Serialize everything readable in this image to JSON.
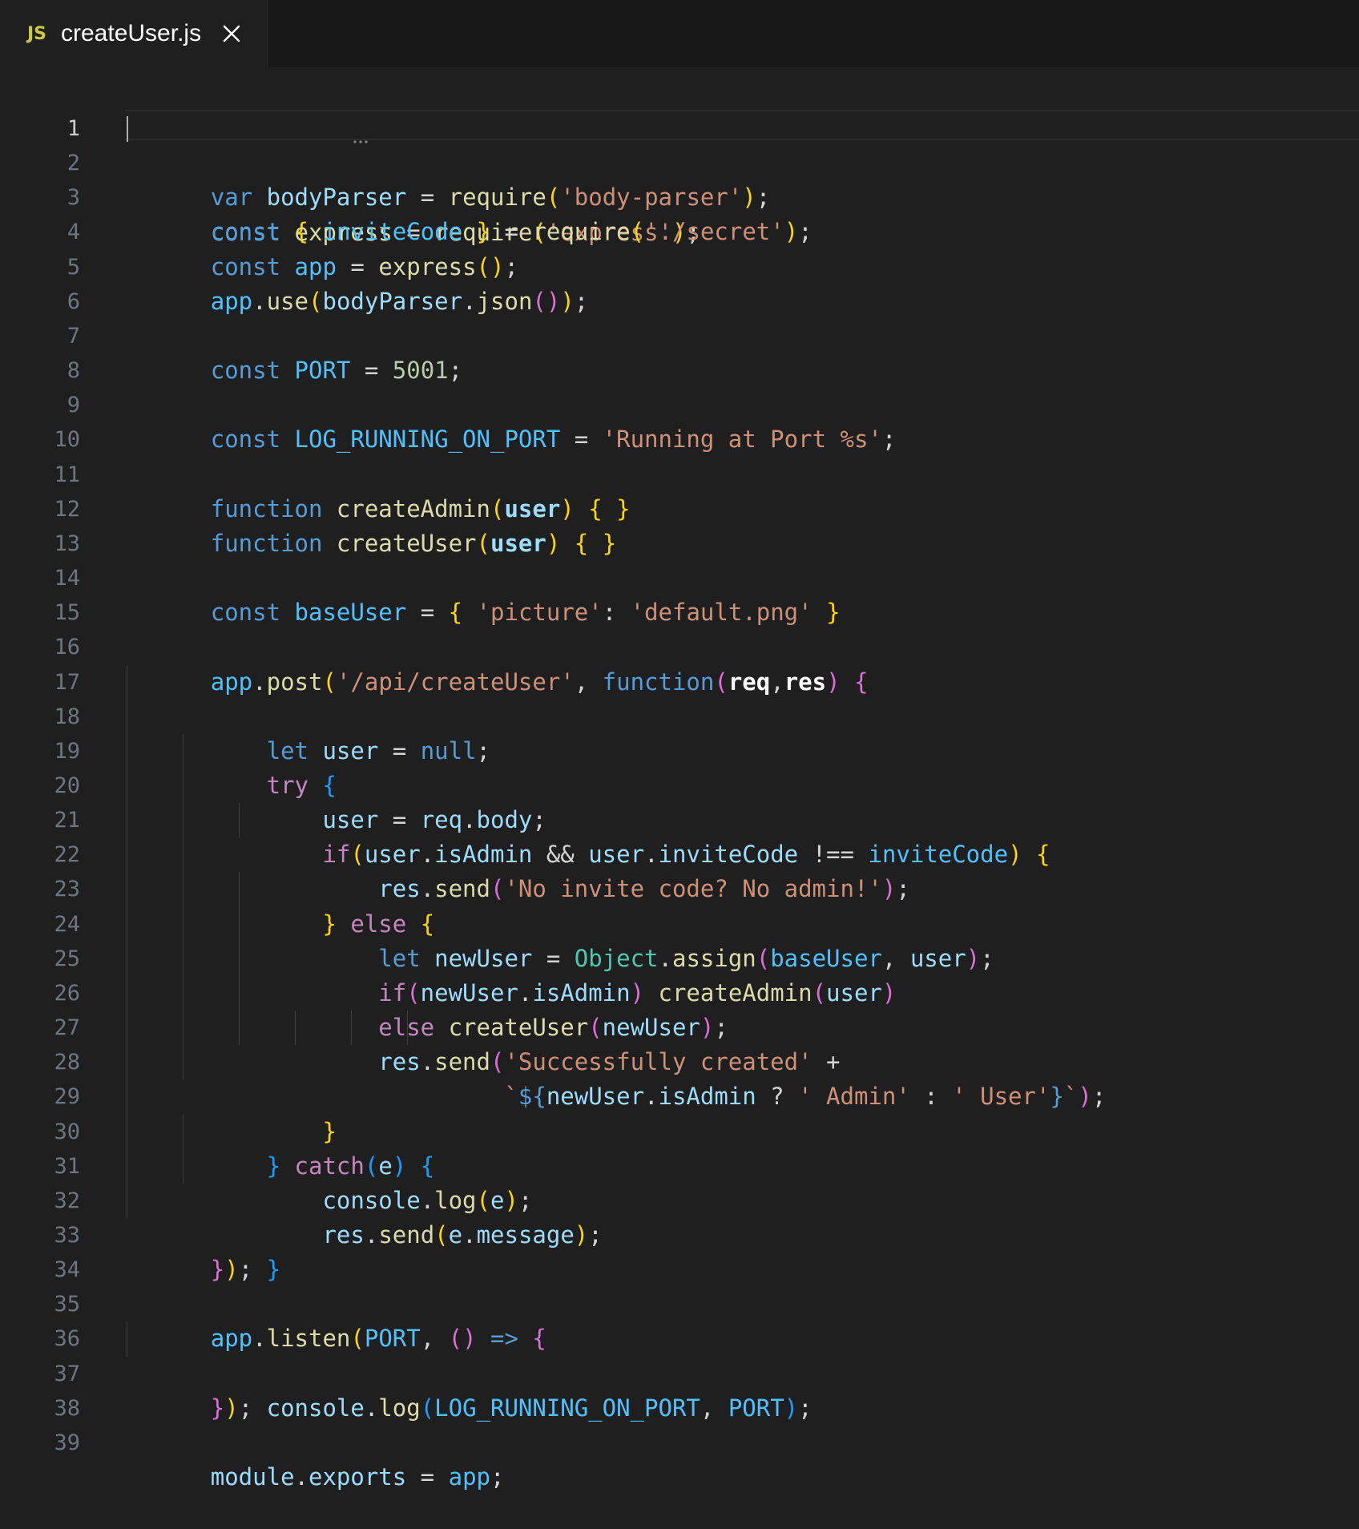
{
  "tab": {
    "icon": "JS",
    "title": "createUser.js",
    "close_icon": "close-icon"
  },
  "editor": {
    "active_line": 1,
    "line_numbers": [
      "1",
      "2",
      "3",
      "4",
      "5",
      "6",
      "7",
      "8",
      "9",
      "10",
      "11",
      "12",
      "13",
      "14",
      "15",
      "16",
      "17",
      "18",
      "19",
      "20",
      "21",
      "22",
      "23",
      "24",
      "25",
      "26",
      "27",
      "28",
      "29",
      "30",
      "31",
      "32",
      "33",
      "34",
      "35",
      "36",
      "37",
      "38",
      "39"
    ]
  },
  "code": {
    "l1": {
      "t1": "const",
      "t2": " ",
      "t3": "express",
      "t4": " = ",
      "t5": "require",
      "t6": "(",
      "t7": "'express'",
      "t8": ")",
      "t9": ";"
    },
    "l2": {
      "t1": "var",
      "t2": " ",
      "t3": "bodyParser",
      "t4": " = ",
      "t5": "require",
      "t6": "(",
      "t7": "'body-parser'",
      "t8": ")",
      "t9": ";"
    },
    "l3": {
      "t1": "const",
      "t2": " ",
      "t3": "{",
      "t4": " ",
      "t5": "inviteCode",
      "t6": " ",
      "t7": "}",
      "t8": " = ",
      "t9": "require",
      "t10": "(",
      "t11": "'./secret'",
      "t12": ")",
      "t13": ";"
    },
    "l4": {
      "t1": "const",
      "t2": " ",
      "t3": "app",
      "t4": " = ",
      "t5": "express",
      "t6": "()",
      "t7": ";"
    },
    "l5": {
      "t1": "app",
      "t2": ".",
      "t3": "use",
      "t4": "(",
      "t5": "bodyParser",
      "t6": ".",
      "t7": "json",
      "t8": "()",
      "t9": ")",
      "t10": ";"
    },
    "l7": {
      "t1": "const",
      "t2": " ",
      "t3": "PORT",
      "t4": " = ",
      "t5": "5001",
      "t6": ";"
    },
    "l9": {
      "t1": "const",
      "t2": " ",
      "t3": "LOG_RUNNING_ON_PORT",
      "t4": " = ",
      "t5": "'Running at Port %s'",
      "t6": ";"
    },
    "l11": {
      "t1": "function",
      "t2": " ",
      "t3": "createAdmin",
      "t4": "(",
      "t5": "user",
      "t6": ")",
      "t7": " ",
      "t8": "{ }"
    },
    "l12": {
      "t1": "function",
      "t2": " ",
      "t3": "createUser",
      "t4": "(",
      "t5": "user",
      "t6": ")",
      "t7": " ",
      "t8": "{ }"
    },
    "l14": {
      "t1": "const",
      "t2": " ",
      "t3": "baseUser",
      "t4": " = ",
      "t5": "{",
      "t6": " ",
      "t7": "'picture'",
      "t8": ": ",
      "t9": "'default.png'",
      "t10": " ",
      "t11": "}"
    },
    "l16": {
      "t1": "app",
      "t2": ".",
      "t3": "post",
      "t4": "(",
      "t5": "'/api/createUser'",
      "t6": ", ",
      "t7": "function",
      "t8": "(",
      "t9": "req",
      "t10": ",",
      "t11": "res",
      "t12": ")",
      "t13": " ",
      "t14": "{"
    },
    "l17": {
      "t1": "let",
      "t2": " ",
      "t3": "user",
      "t4": " = ",
      "t5": "null",
      "t6": ";"
    },
    "l18": {
      "t1": "try",
      "t2": " ",
      "t3": "{"
    },
    "l19": {
      "t1": "user",
      "t2": " = ",
      "t3": "req",
      "t4": ".",
      "t5": "body",
      "t6": ";"
    },
    "l20": {
      "t1": "if",
      "t2": "(",
      "t3": "user",
      "t4": ".",
      "t5": "isAdmin",
      "t6": " && ",
      "t7": "user",
      "t8": ".",
      "t9": "inviteCode",
      "t10": " !== ",
      "t11": "inviteCode",
      "t12": ")",
      "t13": " ",
      "t14": "{"
    },
    "l21": {
      "t1": "res",
      "t2": ".",
      "t3": "send",
      "t4": "(",
      "t5": "'No invite code? No admin!'",
      "t6": ")",
      "t7": ";"
    },
    "l22": {
      "t1": "}",
      "t2": " ",
      "t3": "else",
      "t4": " ",
      "t5": "{"
    },
    "l23": {
      "t1": "let",
      "t2": " ",
      "t3": "newUser",
      "t4": " = ",
      "t5": "Object",
      "t6": ".",
      "t7": "assign",
      "t8": "(",
      "t9": "baseUser",
      "t10": ", ",
      "t11": "user",
      "t12": ")",
      "t13": ";"
    },
    "l24": {
      "t1": "if",
      "t2": "(",
      "t3": "newUser",
      "t4": ".",
      "t5": "isAdmin",
      "t6": ")",
      "t7": " ",
      "t8": "createAdmin",
      "t9": "(",
      "t10": "user",
      "t11": ")"
    },
    "l25": {
      "t1": "else",
      "t2": " ",
      "t3": "createUser",
      "t4": "(",
      "t5": "newUser",
      "t6": ")",
      "t7": ";"
    },
    "l26": {
      "t1": "res",
      "t2": ".",
      "t3": "send",
      "t4": "(",
      "t5": "'Successfully created'",
      "t6": " +"
    },
    "l27": {
      "t1": "`",
      "t2": "${",
      "t3": "newUser",
      "t4": ".",
      "t5": "isAdmin",
      "t6": " ? ",
      "t7": "' Admin'",
      "t8": " : ",
      "t9": "' User'",
      "t10": "}",
      "t11": "`",
      "t12": ")",
      "t13": ";"
    },
    "l28": {
      "t1": "}"
    },
    "l29": {
      "t1": "}",
      "t2": " ",
      "t3": "catch",
      "t4": "(",
      "t5": "e",
      "t6": ")",
      "t7": " ",
      "t8": "{"
    },
    "l30": {
      "t1": "console",
      "t2": ".",
      "t3": "log",
      "t4": "(",
      "t5": "e",
      "t6": ")",
      "t7": ";"
    },
    "l31": {
      "t1": "res",
      "t2": ".",
      "t3": "send",
      "t4": "(",
      "t5": "e",
      "t6": ".",
      "t7": "message",
      "t8": ")",
      "t9": ";"
    },
    "l32": {
      "t1": "}"
    },
    "l33": {
      "t1": "}",
      "t2": ")",
      "t3": ";"
    },
    "l35": {
      "t1": "app",
      "t2": ".",
      "t3": "listen",
      "t4": "(",
      "t5": "PORT",
      "t6": ", ",
      "t7": "()",
      "t8": " => ",
      "t9": "{"
    },
    "l36": {
      "t1": "console",
      "t2": ".",
      "t3": "log",
      "t4": "(",
      "t5": "LOG_RUNNING_ON_PORT",
      "t6": ", ",
      "t7": "PORT",
      "t8": ")",
      "t9": ";"
    },
    "l37": {
      "t1": "}",
      "t2": ")",
      "t3": ";"
    },
    "l39": {
      "t1": "module",
      "t2": ".",
      "t3": "exports",
      "t4": " = ",
      "t5": "app",
      "t6": ";"
    }
  },
  "colors": {
    "background": "#1f1f1f",
    "tab_bar": "#181818",
    "keyword": "#569cd6",
    "control": "#c586c0",
    "function": "#dcdcaa",
    "string": "#ce9178",
    "variable": "#9cdcfe",
    "constant": "#4fc1ff",
    "number": "#b5cea8",
    "class": "#4ec9b0",
    "bracket_level1": "#ffd700",
    "bracket_level2": "#da70d6",
    "bracket_level3": "#179fff",
    "js_icon": "#cbcb41"
  }
}
